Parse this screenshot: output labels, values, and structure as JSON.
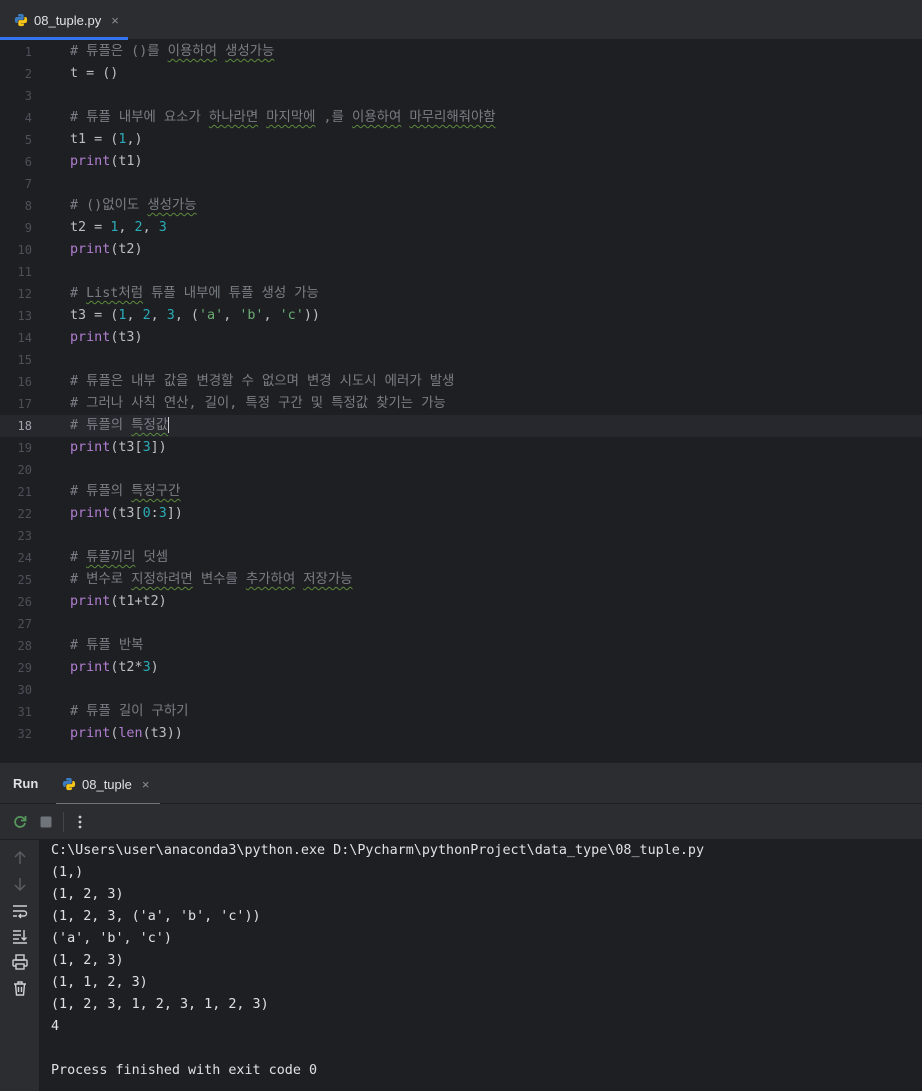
{
  "tab": {
    "filename": "08_tuple.py",
    "close": "×",
    "icon": "python-file-icon"
  },
  "editor": {
    "current_line": 18,
    "lines": [
      [
        {
          "t": "# 튜플은 ()를 ",
          "c": "comment"
        },
        {
          "t": "이용하여",
          "c": "comment",
          "w": true
        },
        {
          "t": " ",
          "c": "comment"
        },
        {
          "t": "생성가능",
          "c": "comment",
          "w": true
        }
      ],
      [
        {
          "t": "t = ()",
          "c": "plain"
        }
      ],
      [],
      [
        {
          "t": "# 튜플 내부에 요소가 ",
          "c": "comment"
        },
        {
          "t": "하나라면",
          "c": "comment",
          "w": true
        },
        {
          "t": " ",
          "c": "comment"
        },
        {
          "t": "마지막에",
          "c": "comment",
          "w": true
        },
        {
          "t": " ,를 ",
          "c": "comment"
        },
        {
          "t": "이용하여",
          "c": "comment",
          "w": true
        },
        {
          "t": " ",
          "c": "comment"
        },
        {
          "t": "마무리해줘야함",
          "c": "comment",
          "w": true
        }
      ],
      [
        {
          "t": "t1 = (",
          "c": "plain"
        },
        {
          "t": "1",
          "c": "num"
        },
        {
          "t": ",)",
          "c": "plain"
        }
      ],
      [
        {
          "t": "print",
          "c": "fn"
        },
        {
          "t": "(t1)",
          "c": "plain"
        }
      ],
      [],
      [
        {
          "t": "# ()없이도 ",
          "c": "comment"
        },
        {
          "t": "생성가능",
          "c": "comment",
          "w": true
        }
      ],
      [
        {
          "t": "t2 = ",
          "c": "plain"
        },
        {
          "t": "1",
          "c": "num"
        },
        {
          "t": ", ",
          "c": "plain"
        },
        {
          "t": "2",
          "c": "num"
        },
        {
          "t": ", ",
          "c": "plain"
        },
        {
          "t": "3",
          "c": "num"
        }
      ],
      [
        {
          "t": "print",
          "c": "fn"
        },
        {
          "t": "(t2)",
          "c": "plain"
        }
      ],
      [],
      [
        {
          "t": "# ",
          "c": "comment"
        },
        {
          "t": "List처럼",
          "c": "comment",
          "w": true
        },
        {
          "t": " 튜플 내부에 튜플 생성 가능",
          "c": "comment"
        }
      ],
      [
        {
          "t": "t3 = (",
          "c": "plain"
        },
        {
          "t": "1",
          "c": "num"
        },
        {
          "t": ", ",
          "c": "plain"
        },
        {
          "t": "2",
          "c": "num"
        },
        {
          "t": ", ",
          "c": "plain"
        },
        {
          "t": "3",
          "c": "num"
        },
        {
          "t": ", (",
          "c": "plain"
        },
        {
          "t": "'a'",
          "c": "str"
        },
        {
          "t": ", ",
          "c": "plain"
        },
        {
          "t": "'b'",
          "c": "str"
        },
        {
          "t": ", ",
          "c": "plain"
        },
        {
          "t": "'c'",
          "c": "str"
        },
        {
          "t": "))",
          "c": "plain"
        }
      ],
      [
        {
          "t": "print",
          "c": "fn"
        },
        {
          "t": "(t3)",
          "c": "plain"
        }
      ],
      [],
      [
        {
          "t": "# 튜플은 내부 값을 변경할 수 없으며 변경 시도시 에러가 발생",
          "c": "comment"
        }
      ],
      [
        {
          "t": "# 그러나 사칙 연산, 길이, 특정 구간 및 특정값 찾기는 가능",
          "c": "comment"
        }
      ],
      [
        {
          "t": "# 튜플의 ",
          "c": "comment"
        },
        {
          "t": "특정값",
          "c": "comment",
          "w": true
        }
      ],
      [
        {
          "t": "print",
          "c": "fn"
        },
        {
          "t": "(t3[",
          "c": "plain"
        },
        {
          "t": "3",
          "c": "num"
        },
        {
          "t": "])",
          "c": "plain"
        }
      ],
      [],
      [
        {
          "t": "# 튜플의 ",
          "c": "comment"
        },
        {
          "t": "특정구간",
          "c": "comment",
          "w": true
        }
      ],
      [
        {
          "t": "print",
          "c": "fn"
        },
        {
          "t": "(t3[",
          "c": "plain"
        },
        {
          "t": "0",
          "c": "num"
        },
        {
          "t": ":",
          "c": "plain"
        },
        {
          "t": "3",
          "c": "num"
        },
        {
          "t": "])",
          "c": "plain"
        }
      ],
      [],
      [
        {
          "t": "# ",
          "c": "comment"
        },
        {
          "t": "튜플끼리",
          "c": "comment",
          "w": true
        },
        {
          "t": " 덧셈",
          "c": "comment"
        }
      ],
      [
        {
          "t": "# 변수로 ",
          "c": "comment"
        },
        {
          "t": "지정하려면",
          "c": "comment",
          "w": true
        },
        {
          "t": " 변수를 ",
          "c": "comment"
        },
        {
          "t": "추가하여",
          "c": "comment",
          "w": true
        },
        {
          "t": " ",
          "c": "comment"
        },
        {
          "t": "저장가능",
          "c": "comment",
          "w": true
        }
      ],
      [
        {
          "t": "print",
          "c": "fn"
        },
        {
          "t": "(t1+t2)",
          "c": "plain"
        }
      ],
      [],
      [
        {
          "t": "# 튜플 반복",
          "c": "comment"
        }
      ],
      [
        {
          "t": "print",
          "c": "fn"
        },
        {
          "t": "(t2*",
          "c": "plain"
        },
        {
          "t": "3",
          "c": "num"
        },
        {
          "t": ")",
          "c": "plain"
        }
      ],
      [],
      [
        {
          "t": "# 튜플 길이 구하기",
          "c": "comment"
        }
      ],
      [
        {
          "t": "print",
          "c": "fn"
        },
        {
          "t": "(",
          "c": "plain"
        },
        {
          "t": "len",
          "c": "fn"
        },
        {
          "t": "(t3))",
          "c": "plain"
        }
      ]
    ]
  },
  "run_panel": {
    "title": "Run",
    "tab_label": "08_tuple",
    "tab_close": "×",
    "toolbar_icons": [
      "rerun-icon",
      "stop-icon",
      "more-options-icon"
    ],
    "side_icons": [
      "scroll-up-icon",
      "scroll-down-icon",
      "soft-wrap-icon",
      "scroll-to-end-icon",
      "print-icon",
      "trash-icon"
    ],
    "output": [
      "C:\\Users\\user\\anaconda3\\python.exe D:\\Pycharm\\pythonProject\\data_type\\08_tuple.py",
      "(1,)",
      "(1, 2, 3)",
      "(1, 2, 3, ('a', 'b', 'c'))",
      "('a', 'b', 'c')",
      "(1, 2, 3)",
      "(1, 1, 2, 3)",
      "(1, 2, 3, 1, 2, 3, 1, 2, 3)",
      "4",
      "",
      "Process finished with exit code 0"
    ]
  }
}
